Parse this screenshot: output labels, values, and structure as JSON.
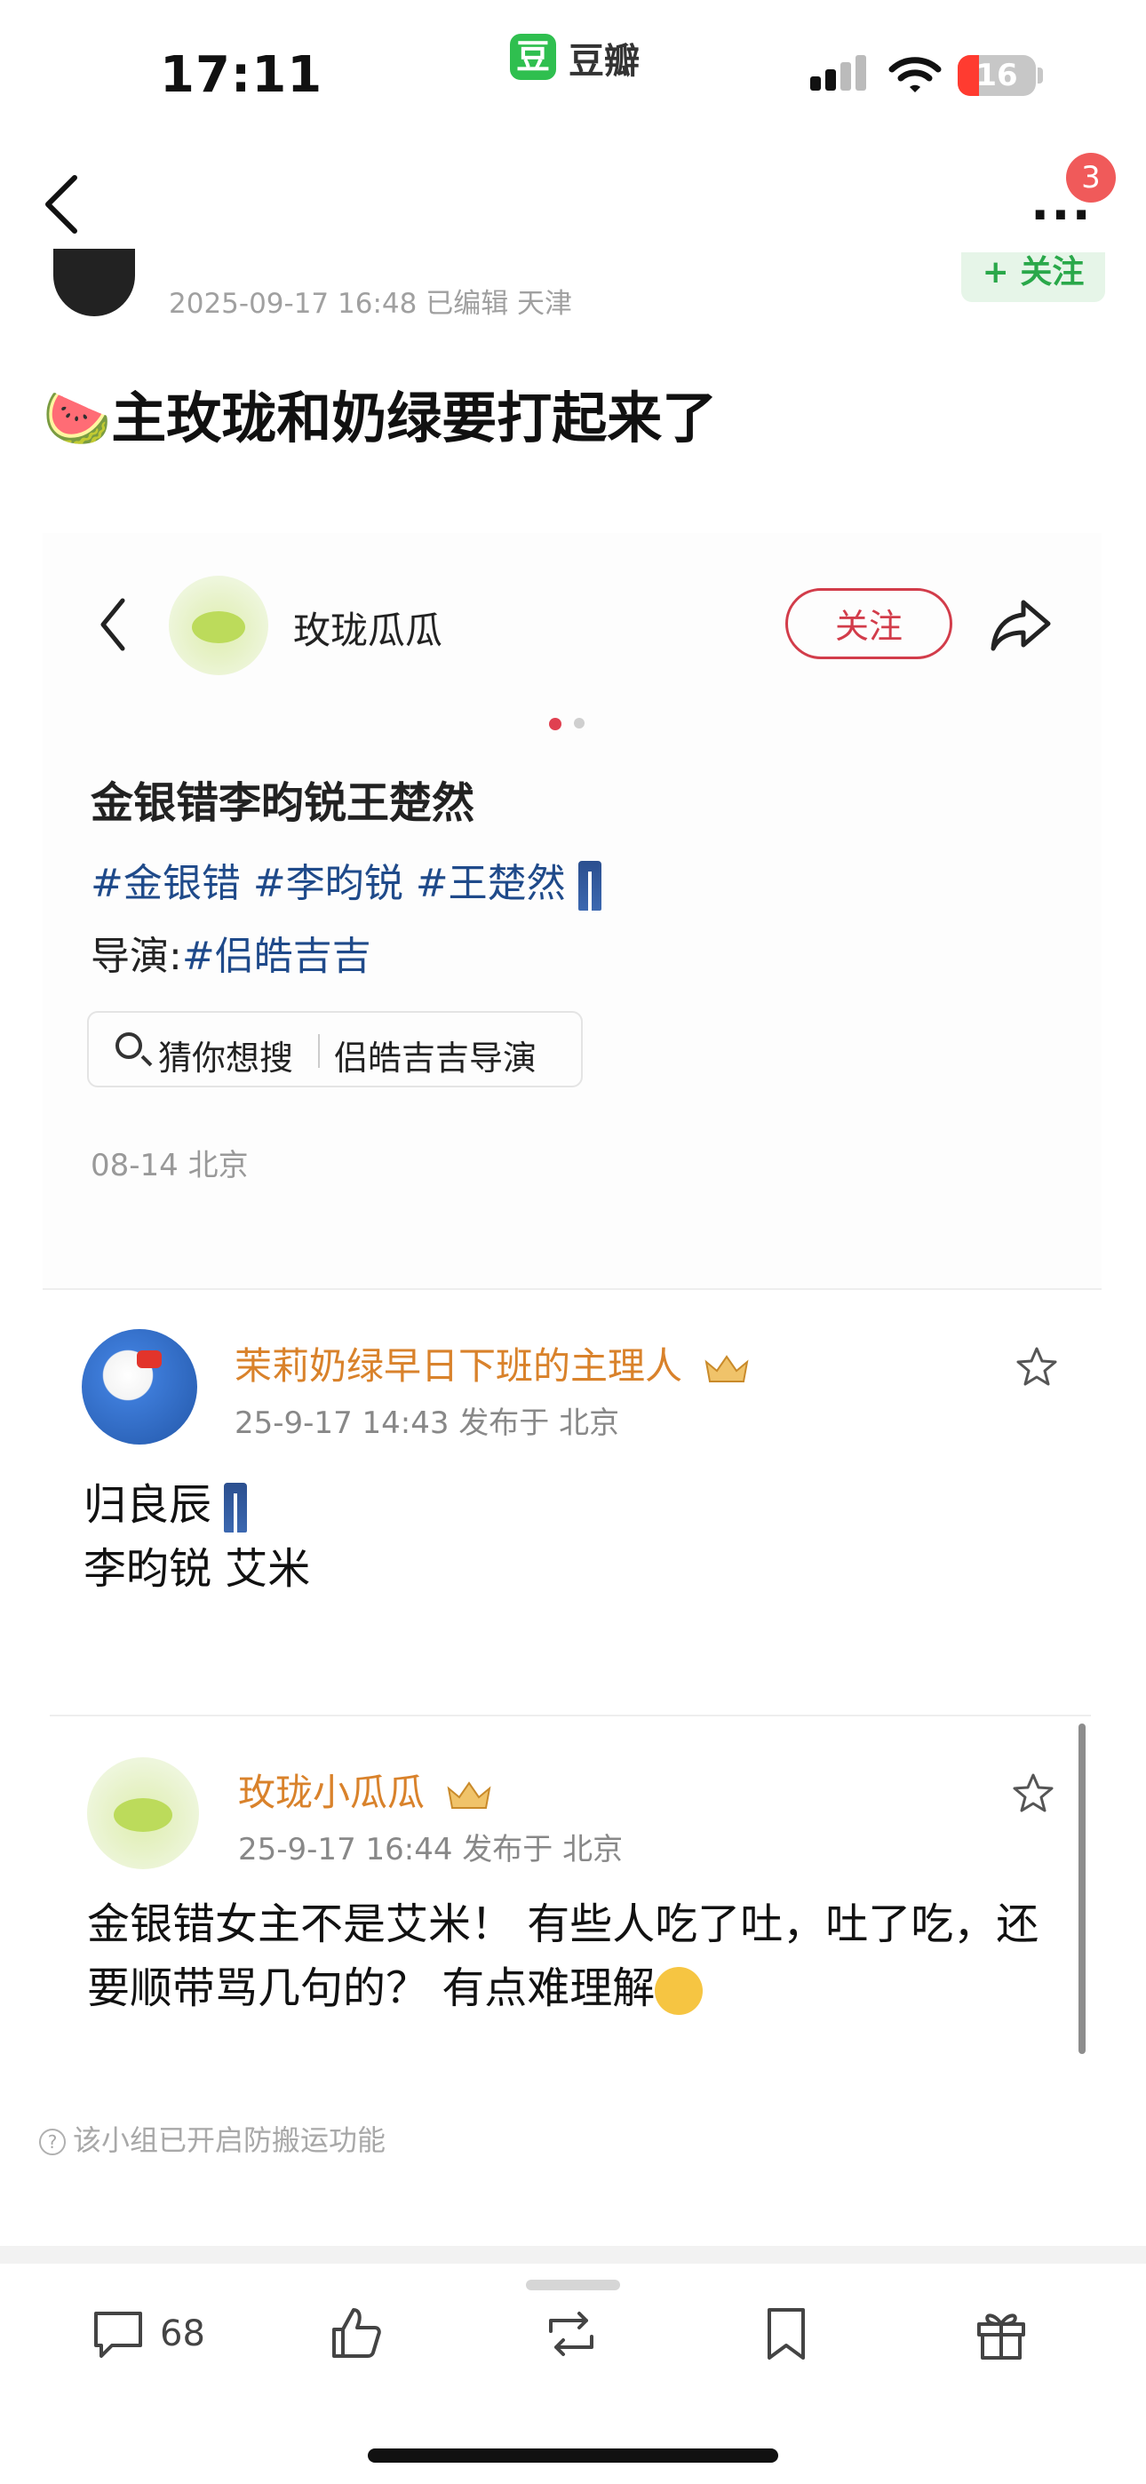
{
  "status_bar": {
    "time": "17:11",
    "app_badge": "豆",
    "app_name": "豆瓣",
    "battery": "16"
  },
  "nav": {
    "notification_count": "3"
  },
  "post": {
    "meta": "2025-09-17 16:48  已编辑  天津",
    "follow_label": "+ 关注",
    "title": "🍉主玫珑和奶绿要打起来了"
  },
  "embed": {
    "account_name": "玫珑瓜瓜",
    "follow_label": "关注",
    "title": "金银错李昀锐王楚然",
    "tags": "#金银错 #李昀锐 #王楚然",
    "director_label": "导演:",
    "director_tag": "#侣皓吉吉",
    "search_prefix": "猜你想搜",
    "search_query": "侣皓吉吉导演",
    "date_location": "08-14 北京"
  },
  "comments": [
    {
      "name": "茉莉奶绿早日下班的主理人",
      "meta": "25-9-17 14:43   发布于 北京",
      "line1": "归良辰",
      "line2": "李昀锐 艾米"
    },
    {
      "name": "玫珑小瓜瓜",
      "meta": "25-9-17 16:44   发布于 北京",
      "body": "金银错女主不是艾米！ 有些人吃了吐，吐了吃，还要顺带骂几句的？ 有点难理解"
    }
  ],
  "notice": "该小组已开启防搬运功能",
  "bottom_bar": {
    "comment_count": "68"
  },
  "colors": {
    "douban_green": "#2fbf4f",
    "accent_red": "#d23c4a",
    "username_orange": "#d9822b",
    "tag_blue": "#1f4a8a"
  },
  "icons": [
    "back-icon",
    "more-icon",
    "share-icon",
    "search-icon",
    "star-icon",
    "comment-icon",
    "like-icon",
    "repost-icon",
    "bookmark-icon",
    "gift-icon"
  ]
}
